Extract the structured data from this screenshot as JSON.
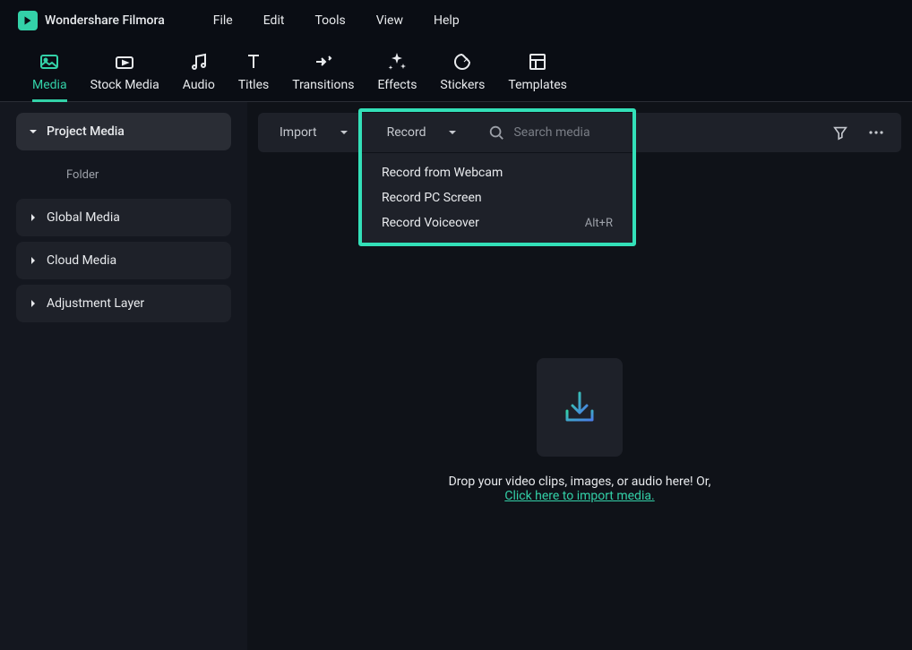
{
  "app_title": "Wondershare Filmora",
  "menu_bar": [
    "File",
    "Edit",
    "Tools",
    "View",
    "Help"
  ],
  "top_tabs": [
    {
      "label": "Media",
      "active": true
    },
    {
      "label": "Stock Media",
      "active": false
    },
    {
      "label": "Audio",
      "active": false
    },
    {
      "label": "Titles",
      "active": false
    },
    {
      "label": "Transitions",
      "active": false
    },
    {
      "label": "Effects",
      "active": false
    },
    {
      "label": "Stickers",
      "active": false
    },
    {
      "label": "Templates",
      "active": false
    }
  ],
  "sidebar": {
    "project_media": "Project Media",
    "folder": "Folder",
    "global_media": "Global Media",
    "cloud_media": "Cloud Media",
    "adjustment_layer": "Adjustment Layer"
  },
  "toolbar": {
    "import": "Import",
    "record": "Record",
    "search_placeholder": "Search media"
  },
  "record_menu": [
    {
      "label": "Record from Webcam",
      "shortcut": ""
    },
    {
      "label": "Record PC Screen",
      "shortcut": ""
    },
    {
      "label": "Record Voiceover",
      "shortcut": "Alt+R"
    }
  ],
  "dropzone": {
    "text": "Drop your video clips, images, or audio here! Or,",
    "link": "Click here to import media."
  }
}
